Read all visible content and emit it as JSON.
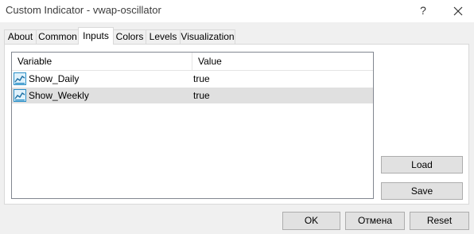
{
  "window": {
    "title": "Custom Indicator - vwap-oscillator",
    "help_glyph": "?",
    "close_icon": "close-icon"
  },
  "tabs": [
    {
      "label": "About",
      "active": false
    },
    {
      "label": "Common",
      "active": false
    },
    {
      "label": "Inputs",
      "active": true
    },
    {
      "label": "Colors",
      "active": false
    },
    {
      "label": "Levels",
      "active": false
    },
    {
      "label": "Visualization",
      "active": false
    }
  ],
  "grid": {
    "columns": [
      "Variable",
      "Value"
    ],
    "rows": [
      {
        "name": "Show_Daily",
        "value": "true",
        "selected": false,
        "icon": "parameter-icon"
      },
      {
        "name": "Show_Weekly",
        "value": "true",
        "selected": true,
        "icon": "parameter-icon"
      }
    ]
  },
  "side_buttons": {
    "load": "Load",
    "save": "Save"
  },
  "bottom_buttons": {
    "ok": "OK",
    "cancel": "Отмена",
    "reset": "Reset"
  },
  "colors": {
    "selected_row": "#e0e0e0",
    "icon_accent": "#2a8fc7"
  }
}
